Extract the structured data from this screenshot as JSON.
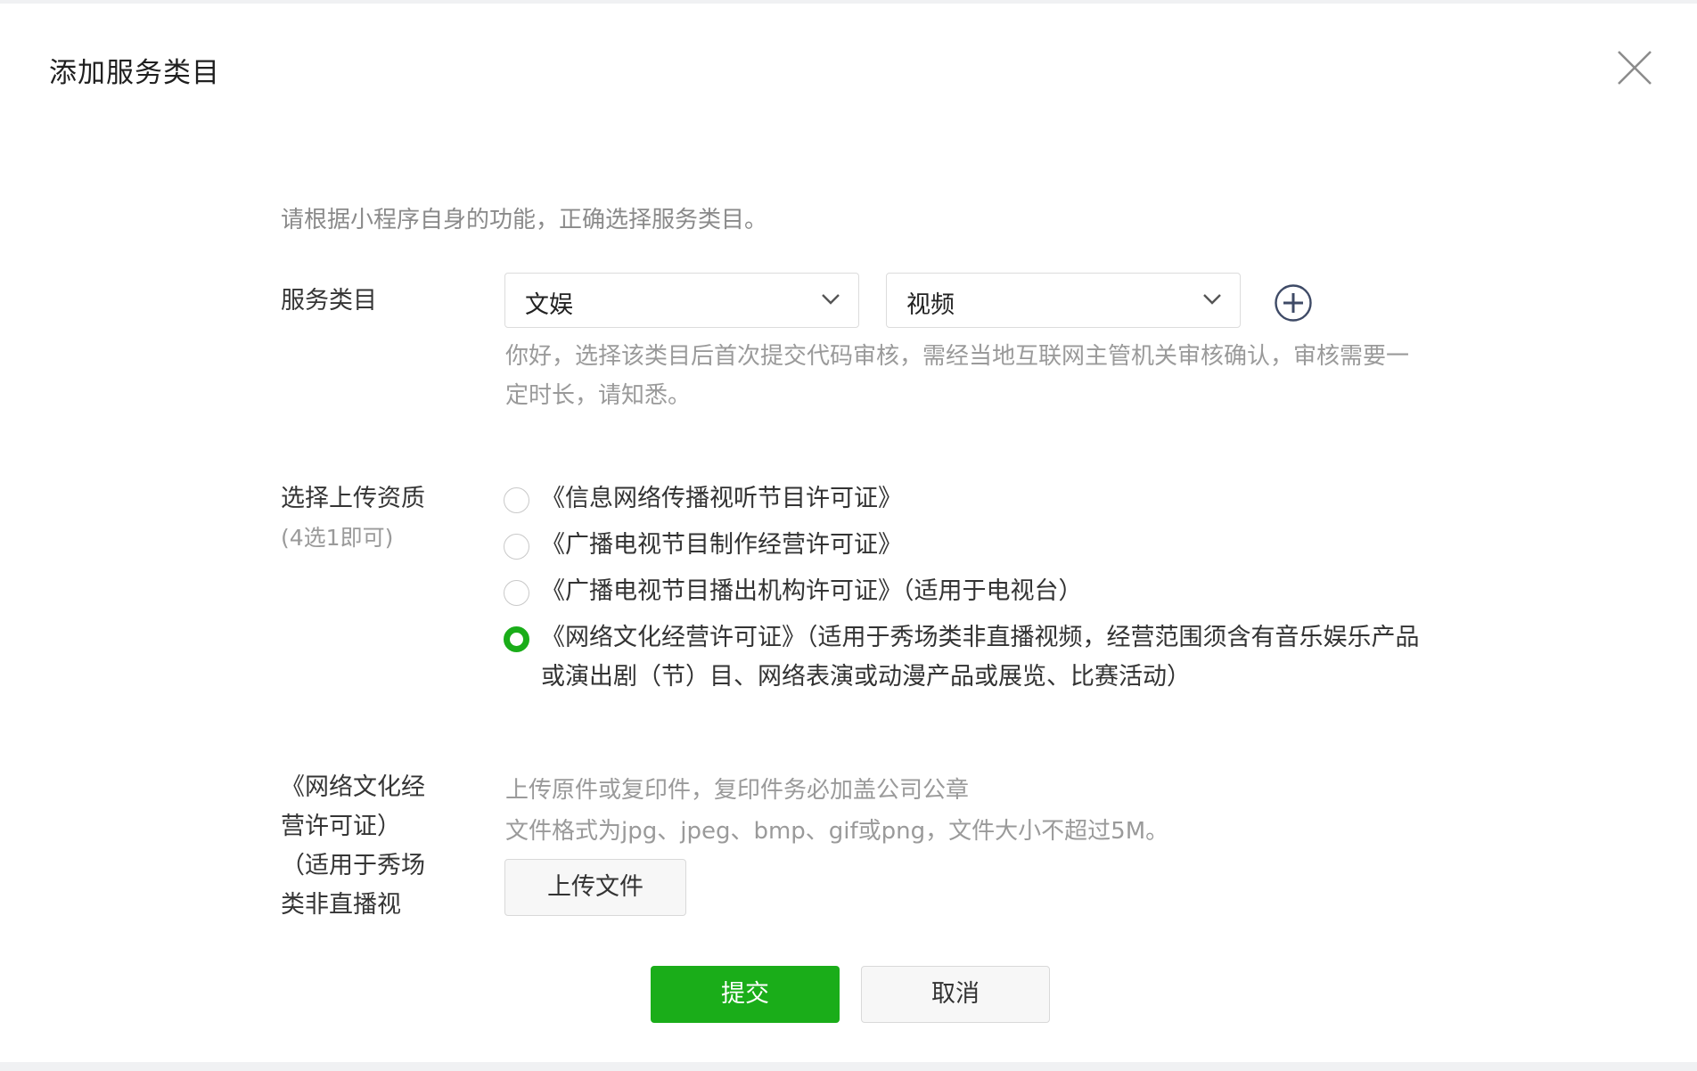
{
  "dialog": {
    "title": "添加服务类目",
    "close_icon": "close-icon"
  },
  "intro": "请根据小程序自身的功能，正确选择服务类目。",
  "category": {
    "label": "服务类目",
    "primary_value": "文娱",
    "secondary_value": "视频",
    "notice": "你好，选择该类目后首次提交代码审核，需经当地互联网主管机关审核确认，审核需要一定时长，请知悉。"
  },
  "qualification": {
    "label": "选择上传资质",
    "sublabel": "(4选1即可)",
    "options": [
      {
        "text": "《信息网络传播视听节目许可证》",
        "selected": false
      },
      {
        "text": "《广播电视节目制作经营许可证》",
        "selected": false
      },
      {
        "text": "《广播电视节目播出机构许可证》（适用于电视台）",
        "selected": false
      },
      {
        "text": "《网络文化经营许可证》（适用于秀场类非直播视频，经营范围须含有音乐娱乐产品或演出剧（节）目、网络表演或动漫产品或展览、比赛活动）",
        "selected": true
      }
    ]
  },
  "upload": {
    "label_lines": [
      "《网络文化经",
      "营许可证）",
      "（适用于秀场",
      "类非直播视"
    ],
    "hint_line1": "上传原件或复印件，复印件务必加盖公司公章",
    "hint_line2": "文件格式为jpg、jpeg、bmp、gif或png，文件大小不超过5M。",
    "button_label": "上传文件"
  },
  "actions": {
    "submit_label": "提交",
    "cancel_label": "取消"
  },
  "colors": {
    "accent": "#1aad19",
    "text": "#333333",
    "muted": "#9a9a9a"
  }
}
